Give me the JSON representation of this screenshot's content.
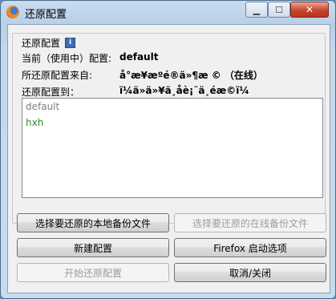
{
  "window": {
    "title": "还原配置"
  },
  "group": {
    "title": "还原配置"
  },
  "info": {
    "current_label": "当前（使用中）配置:",
    "current_value": "default",
    "source_label": "所还原配置来自:",
    "source_value": "å°æ¥æºé®ä»¶æ  © （在线）",
    "target_label": "还原配置到：",
    "target_value": "ï¼ä»ä»¥ä¸åè¡¨ä¸­éæ©ï¼"
  },
  "profiles": [
    {
      "name": "default",
      "color": "#808080"
    },
    {
      "name": "hxh",
      "color": "#2e8b2e"
    }
  ],
  "buttons": {
    "choose_local": "选择要还原的本地备份文件",
    "choose_online": "选择要还原的在线备份文件",
    "new_profile": "新建配置",
    "firefox_options": "Firefox 启动选项",
    "start_restore": "开始还原配置",
    "cancel_close": "取消/关闭"
  }
}
